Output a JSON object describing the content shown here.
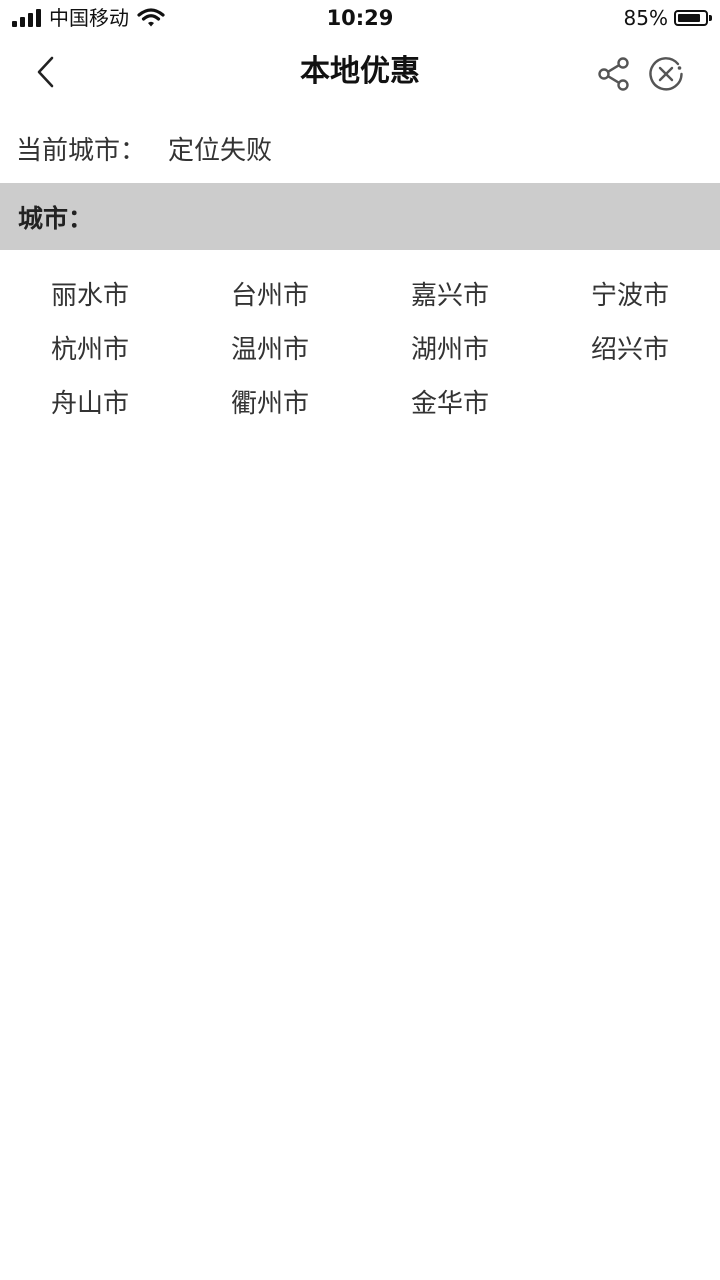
{
  "status_bar": {
    "carrier": "中国移动",
    "time": "10:29",
    "battery": "85%",
    "battery_level_percent": 85,
    "icons": [
      "signal-icon",
      "wifi-icon",
      "battery-icon"
    ]
  },
  "nav": {
    "title": "本地优惠",
    "icons": [
      "chevron-left-icon",
      "share-icon",
      "close-circle-icon"
    ]
  },
  "current_city": {
    "label": "当前城市：",
    "value": "定位失败"
  },
  "section": {
    "title": "城市："
  },
  "cities": [
    {
      "name": "丽水市"
    },
    {
      "name": "台州市"
    },
    {
      "name": "嘉兴市"
    },
    {
      "name": "宁波市"
    },
    {
      "name": "杭州市"
    },
    {
      "name": "温州市"
    },
    {
      "name": "湖州市"
    },
    {
      "name": "绍兴市"
    },
    {
      "name": "舟山市"
    },
    {
      "name": "衢州市"
    },
    {
      "name": "金华市"
    }
  ],
  "colors": {
    "section_bg": "#cccccc",
    "text": "#333333"
  }
}
